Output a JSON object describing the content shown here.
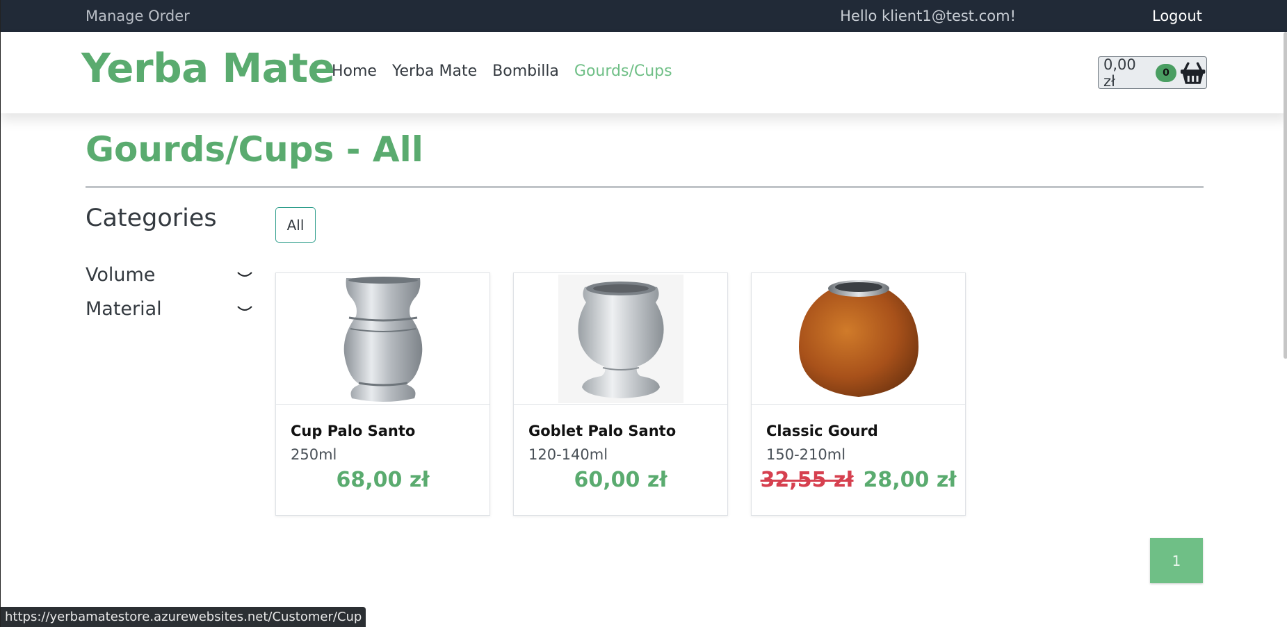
{
  "topbar": {
    "manage_order": "Manage Order",
    "greeting": "Hello klient1@test.com!",
    "logout": "Logout"
  },
  "header": {
    "brand": "Yerba Mate",
    "nav": [
      {
        "label": "Home",
        "active": false
      },
      {
        "label": "Yerba Mate",
        "active": false
      },
      {
        "label": "Bombilla",
        "active": false
      },
      {
        "label": "Gourds/Cups",
        "active": true
      }
    ],
    "cart": {
      "amount": "0,00 zł",
      "count": "0",
      "icon": "basket-icon"
    }
  },
  "page": {
    "title": "Gourds/Cups - All"
  },
  "sidebar": {
    "title": "Categories",
    "items": [
      {
        "label": "Volume",
        "icon": "chevron-down-icon"
      },
      {
        "label": "Material",
        "icon": "chevron-down-icon"
      }
    ]
  },
  "filter": {
    "chip": "All"
  },
  "products": [
    {
      "name": "Cup Palo Santo",
      "volume": "250ml",
      "old_price": "",
      "price": "68,00 zł"
    },
    {
      "name": "Goblet Palo Santo",
      "volume": "120-140ml",
      "old_price": "",
      "price": "60,00 zł"
    },
    {
      "name": "Classic Gourd",
      "volume": "150-210ml",
      "old_price": "32,55 zł",
      "price": "28,00 zł"
    }
  ],
  "pagination": {
    "current": "1"
  },
  "status": {
    "url": "https://yerbamatestore.azurewebsites.net/Customer/Cup"
  },
  "colors": {
    "brand_green": "#5aab6f",
    "sale_red": "#d6404f",
    "topbar_bg": "#212a37"
  }
}
